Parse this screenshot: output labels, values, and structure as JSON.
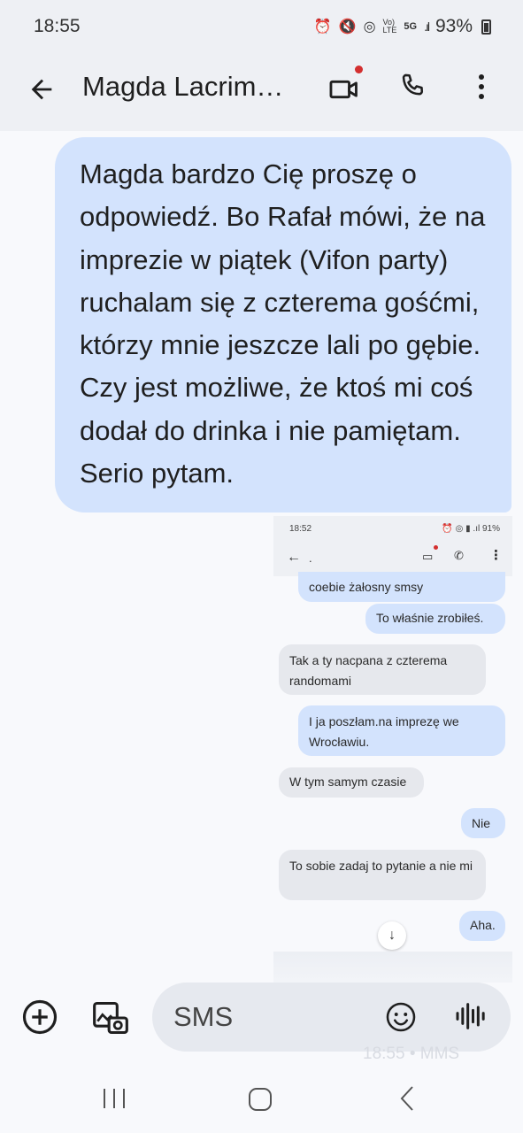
{
  "status_bar": {
    "time": "18:55",
    "network_text": "5G",
    "battery_percent": "93%",
    "icons": [
      "alarm-icon",
      "mute-icon",
      "wifi-icon",
      "volte-icon",
      "5g-icon",
      "signal-icon",
      "battery-icon"
    ]
  },
  "header": {
    "contact_name": "Magda Lacrim…",
    "video_call_has_badge": true,
    "badge_color": "#d32f2f"
  },
  "message": {
    "text": "Magda bardzo Cię proszę o odpowiedź. Bo Rafał mówi, że na imprezie w piątek (Vifon party) ruchalam się z czterema gośćmi, którzy mnie jeszcze lali po gębie. Czy jest możliwe, że ktoś mi coś dodał do drinka i nie pamiętam. Serio pytam.",
    "bubble_color": "#d3e3fd"
  },
  "attachment_screenshot": {
    "status_time": "18:52",
    "battery_percent": "91%",
    "contact_name": ".",
    "messages": [
      {
        "direction": "out",
        "text": "coebie żałosny smsy"
      },
      {
        "direction": "out",
        "text": "To właśnie zrobiłeś."
      },
      {
        "direction": "in",
        "text": "Tak a ty nacpana z czterema randomami"
      },
      {
        "direction": "out",
        "text": "I ja poszłam.na imprezę we Wrocławiu."
      },
      {
        "direction": "in",
        "text": "W tym samym czasie"
      },
      {
        "direction": "out",
        "text": "Nie"
      },
      {
        "direction": "in",
        "text": "To sobie zadaj to pytanie a nie mi"
      },
      {
        "direction": "out",
        "text": "Aha."
      }
    ]
  },
  "compose": {
    "placeholder": "SMS",
    "ghost_timestamp": "18:55 • MMS"
  },
  "colors": {
    "background": "#f8f9fc",
    "header_bg": "#eef0f4",
    "outgoing_bubble": "#d3e3fd",
    "incoming_bubble": "#e6e8ed",
    "compose_bg": "#e6e9ef"
  }
}
